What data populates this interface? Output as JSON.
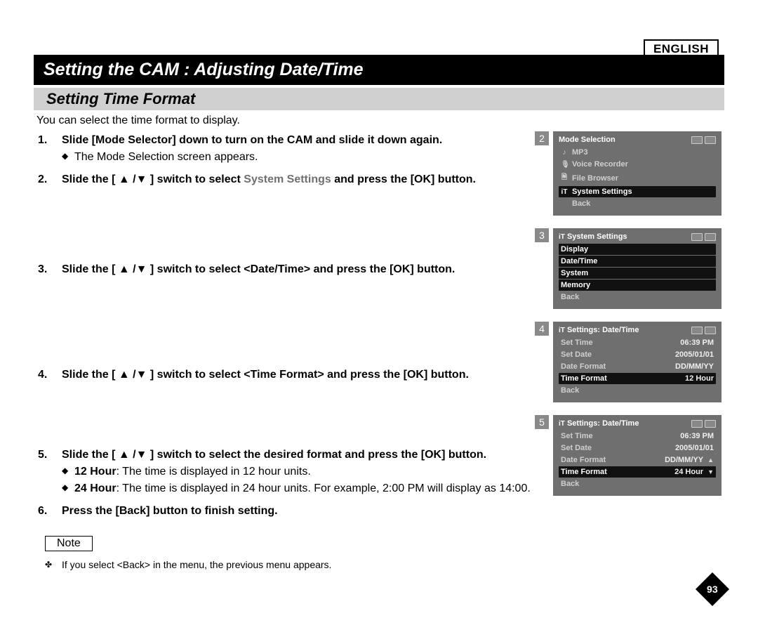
{
  "language_tag": "ENGLISH",
  "main_title": "Setting the CAM : Adjusting Date/Time",
  "section_title": "Setting Time Format",
  "intro": "You can select the time format to display.",
  "steps": [
    {
      "head_parts": [
        "Slide [Mode Selector] down to turn on the CAM and slide it down again."
      ],
      "subs": [
        "The Mode Selection screen appears."
      ]
    },
    {
      "head_parts_mixed": [
        {
          "t": "Slide the [ ▲ /▼ ] switch to select ",
          "g": false
        },
        {
          "t": "System Settings",
          "g": true
        },
        {
          "t": " and press the [OK] button.",
          "g": false
        }
      ]
    },
    {
      "head_parts": [
        "Slide the [ ▲ /▼ ] switch to select <Date/Time> and press the [OK] button."
      ]
    },
    {
      "head_parts": [
        "Slide the [ ▲ /▼ ] switch to select <Time Format> and press the [OK] button."
      ]
    },
    {
      "head_parts": [
        "Slide the [ ▲ /▼ ] switch to select the desired format and press the [OK] button."
      ],
      "detail_subs": [
        {
          "bold": "12 Hour",
          "text": ": The time is displayed in 12 hour units."
        },
        {
          "bold": "24 Hour",
          "text": ": The time is displayed in 24 hour units. For example, 2:00 PM will display as 14:00."
        }
      ]
    },
    {
      "head_parts": [
        "Press the [Back] button to finish setting."
      ]
    }
  ],
  "note_label": "Note",
  "note_item": "If you select <Back> in the menu, the previous menu appears.",
  "screens": {
    "s2": {
      "num": "2",
      "title": "Mode Selection",
      "rows": [
        {
          "ico": "♪",
          "lbl": "MP3",
          "sel": false,
          "dim": true
        },
        {
          "ico": "🎙",
          "lbl": "Voice Recorder",
          "sel": false,
          "dim": true
        },
        {
          "ico": "🗎",
          "lbl": "File Browser",
          "sel": false,
          "dim": true
        },
        {
          "ico": "iT",
          "lbl": "System Settings",
          "sel": true
        },
        {
          "ico": "",
          "lbl": "Back",
          "sel": false,
          "dim": true
        }
      ]
    },
    "s3": {
      "num": "3",
      "title_ico": "iT",
      "title": "System Settings",
      "rows": [
        {
          "lbl": "Display",
          "sel": true
        },
        {
          "lbl": "Date/Time",
          "sel": true
        },
        {
          "lbl": "System",
          "sel": true
        },
        {
          "lbl": "Memory",
          "sel": true
        },
        {
          "lbl": "Back",
          "sel": false,
          "dim": true
        }
      ]
    },
    "s4": {
      "num": "4",
      "title_ico": "iT",
      "title": "Settings: Date/Time",
      "rows": [
        {
          "lbl": "Set Time",
          "val": "06:39 PM",
          "dim": true
        },
        {
          "lbl": "Set Date",
          "val": "2005/01/01",
          "dim": true
        },
        {
          "lbl": "Date Format",
          "val": "DD/MM/YY",
          "dim": true
        },
        {
          "lbl": "Time Format",
          "val": "12 Hour",
          "sel": true
        },
        {
          "lbl": "Back",
          "dim": true
        }
      ]
    },
    "s5": {
      "num": "5",
      "title_ico": "iT",
      "title": "Settings: Date/Time",
      "rows": [
        {
          "lbl": "Set Time",
          "val": "06:39 PM",
          "dim": true
        },
        {
          "lbl": "Set Date",
          "val": "2005/01/01",
          "dim": true
        },
        {
          "lbl": "Date Format",
          "val": "DD/MM/YY",
          "dim": true,
          "tri_up": true
        },
        {
          "lbl": "Time Format",
          "val": "24 Hour",
          "sel": true,
          "tri_down": true
        },
        {
          "lbl": "Back",
          "dim": true
        }
      ]
    }
  },
  "page_number": "93"
}
